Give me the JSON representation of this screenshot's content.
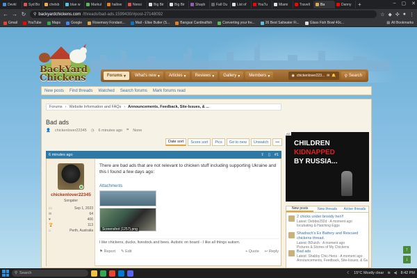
{
  "browser": {
    "tabs": [
      {
        "label": "Devkl",
        "color": "#4a90d9"
      },
      {
        "label": "Syd Bo",
        "color": "#d9534f"
      },
      {
        "label": "chelsb",
        "color": "#f0ad4e"
      },
      {
        "label": "blue w",
        "color": "#5bc0de"
      },
      {
        "label": "Markul",
        "color": "#5cb85c"
      },
      {
        "label": "hallow",
        "color": "#e67e22"
      },
      {
        "label": "Nonsi",
        "color": "#d9534f"
      },
      {
        "label": "Big Bir",
        "color": "#e0e0e0"
      },
      {
        "label": "Big Bir",
        "color": "#e0e0e0"
      },
      {
        "label": "Shayb",
        "color": "#9b59b6"
      },
      {
        "label": "Fall Ou",
        "color": "#666666"
      },
      {
        "label": "List of",
        "color": "#e0e0e0"
      },
      {
        "label": "YouTu",
        "color": "#ff0000"
      },
      {
        "label": "Miami",
        "color": "#e0e0e0"
      },
      {
        "label": "Travell",
        "color": "#ff0000"
      },
      {
        "label": "Ba",
        "color": "#d9a54f",
        "active": true
      },
      {
        "label": "Danny",
        "color": "#ff0000"
      }
    ],
    "new_tab": "+",
    "url_host": "backyardchickens.com",
    "url_path": "/threads/bad-ads.1599430/#post-27148092",
    "bookmarks": [
      {
        "label": "Gmail",
        "color": "#ea4335"
      },
      {
        "label": "YouTube",
        "color": "#ff0000"
      },
      {
        "label": "Maps",
        "color": "#34a853"
      },
      {
        "label": "Google",
        "color": "#4285f4"
      },
      {
        "label": "Rosemary Fondant...",
        "color": "#d9a54f"
      },
      {
        "label": "Mail - Elise Butler (S...",
        "color": "#0078d4"
      },
      {
        "label": "Bangsai Cardinalfish",
        "color": "#e67e22"
      },
      {
        "label": "Converting your fre...",
        "color": "#5cb85c"
      },
      {
        "label": "26 Best Saltwater Fi...",
        "color": "#5bc0de"
      },
      {
        "label": "Glass Fish Bowl 40c...",
        "color": "#e0e0e0"
      }
    ],
    "all_bookmarks": "All Bookmarks"
  },
  "site": {
    "logo_line1": "BackYard",
    "logo_line2": "Chickens"
  },
  "mainnav": {
    "items": [
      {
        "label": "Forums",
        "selected": true
      },
      {
        "label": "What's new"
      },
      {
        "label": "Articles"
      },
      {
        "label": "Reviews"
      },
      {
        "label": "Gallery"
      },
      {
        "label": "Members"
      }
    ],
    "user": "chickenlover223...",
    "search": "Search"
  },
  "subnav": [
    "New posts",
    "Find threads",
    "Watched",
    "Search forums",
    "Mark forums read"
  ],
  "breadcrumbs": [
    "Forums",
    "Website Information and FAQs",
    "Announcements, Feedback, Site-Issues, & ..."
  ],
  "thread": {
    "title": "Bad ads",
    "author": "chickenlover22345",
    "time": "6 minutes ago",
    "tags": "None"
  },
  "sort": [
    {
      "label": "Date sort",
      "selected": true
    },
    {
      "label": "Score sort"
    },
    {
      "label": "Pics"
    },
    {
      "label": "Go to new"
    },
    {
      "label": "Unwatch"
    },
    {
      "label": "•••"
    }
  ],
  "post": {
    "time": "6 minutes ago",
    "number": "#1",
    "user": {
      "name": "chickenlover22345",
      "title": "Songster",
      "stats": [
        {
          "icon": "▭",
          "value": "Sep 1, 2023"
        },
        {
          "icon": "✉",
          "value": "64"
        },
        {
          "icon": "♥",
          "value": "406"
        },
        {
          "icon": "🏆",
          "value": "113"
        },
        {
          "icon": "⌂",
          "value": "Perth, Australia"
        }
      ]
    },
    "body": "There are bad ads that are not relevant to chicken stuff including supporting Ukraine and this I found a few days ago:",
    "attachments_label": "Attachments",
    "attachment2_caption": "Screenshot (1257).png",
    "signature": "I like chickens, ducks, livestock and bees. Autistic on board - I like all things autism.",
    "actions": {
      "report": "Report",
      "edit": "Edit",
      "quote": "+ Quote",
      "reply": "Reply"
    }
  },
  "ad": {
    "tag": "AD",
    "line1": "CHILDREN",
    "line2": "KIDNAPPED",
    "line3": "BY RUSSIA..."
  },
  "sidebar": {
    "tabs": [
      {
        "label": "New posts",
        "selected": true
      },
      {
        "label": "New threads"
      },
      {
        "label": "Active threads"
      }
    ],
    "items": [
      {
        "title": "2 chicks under broody hen!!",
        "lines": [
          "Latest: Debbie292d · A moment ago",
          "Incubating & Hatching Eggs"
        ]
      },
      {
        "title": "Shadrach's Ex Battery and Rescued chickens thread.",
        "lines": [
          "Latest: BDutch · A moment ago",
          "Pictures & Stories of My Chickens"
        ]
      },
      {
        "title": "Bad ads",
        "lines": [
          "Latest: Shabby Chic-Hens · A moment ago",
          "Announcements, Feedback, Site-Issues, & Guides"
        ]
      }
    ]
  },
  "taskbar": {
    "search": "Search",
    "weather": "15°C  Mostly clear",
    "clock": "8:42 PM"
  }
}
